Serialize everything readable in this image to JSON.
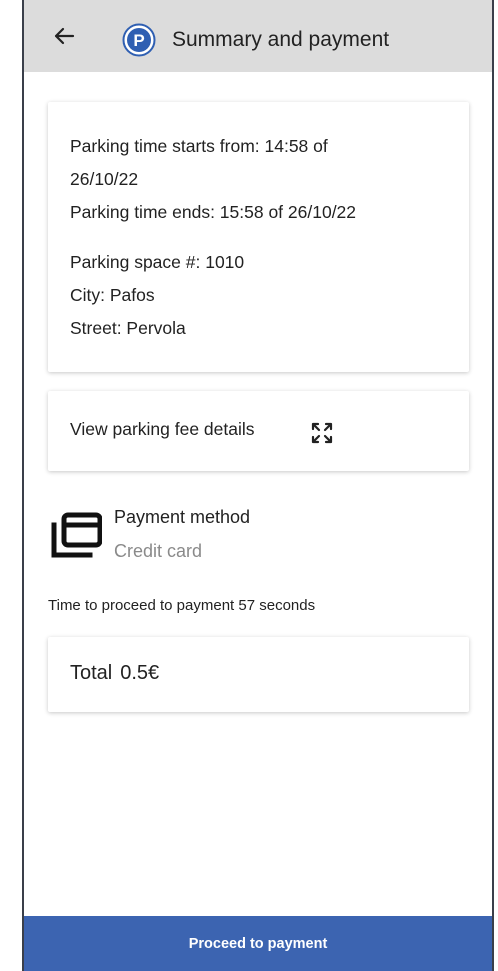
{
  "header": {
    "title": "Summary and payment",
    "back_icon": "arrow-left-icon",
    "logo_icon": "parking-p-icon",
    "logo_letter": "P",
    "logo_color": "#2f5fb2"
  },
  "summary": {
    "start_line_1": "Parking time starts from: 14:58 of",
    "start_line_2": "26/10/22",
    "end_line": "Parking time ends: 15:58 of 26/10/22",
    "space_line": "Parking space #: 1010",
    "city_line": "City: Pafos",
    "street_line": "Street: Pervola"
  },
  "fee_details": {
    "label": "View parking fee details",
    "icon": "expand-icon"
  },
  "payment_method": {
    "icon": "credit-cards-icon",
    "title": "Payment method",
    "value": "Credit card"
  },
  "countdown_text": "Time to proceed to payment 57 seconds",
  "total": {
    "label": "Total",
    "amount": "0.5€"
  },
  "proceed_button": {
    "label": "Proceed to payment",
    "color": "#3c64b1"
  }
}
